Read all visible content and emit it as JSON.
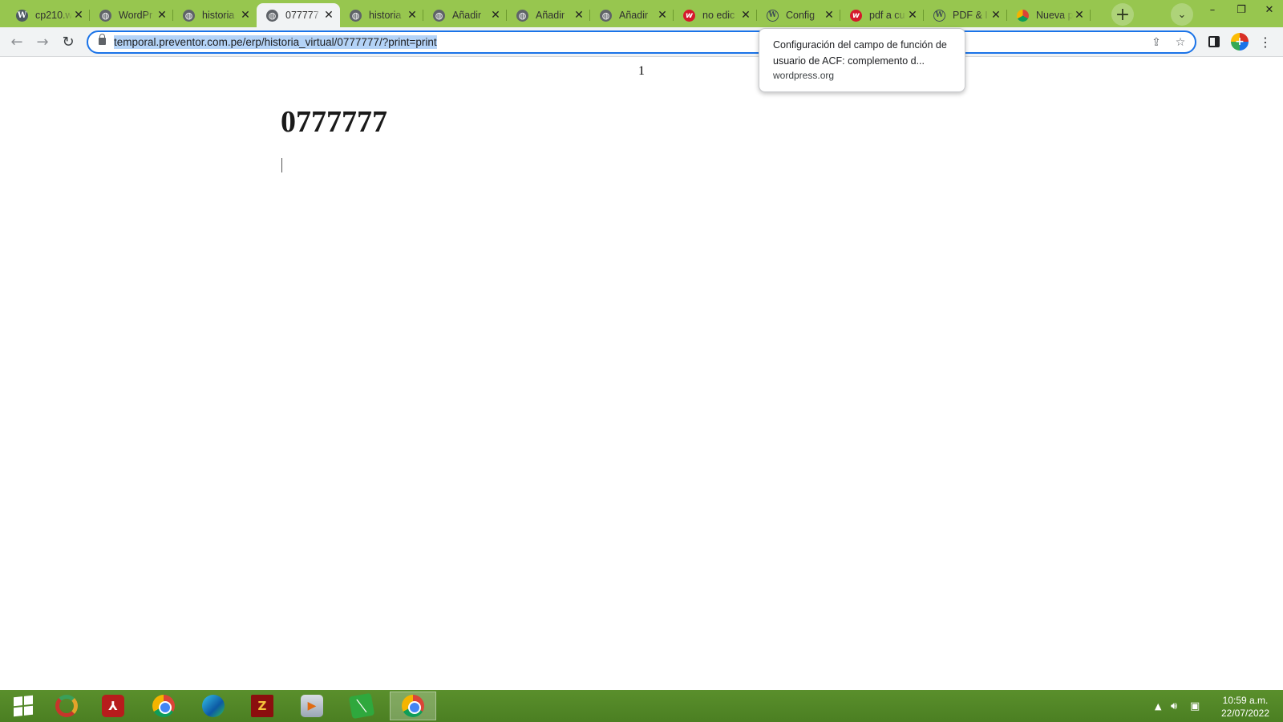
{
  "tabs": [
    {
      "title": "cp210.w",
      "icon": "wp-icon"
    },
    {
      "title": "WordPr",
      "icon": "globe-icon"
    },
    {
      "title": "historia",
      "icon": "globe-icon"
    },
    {
      "title": "077777",
      "icon": "globe-icon",
      "active": true
    },
    {
      "title": "historia",
      "icon": "globe-icon"
    },
    {
      "title": "Añadir",
      "icon": "globe-icon"
    },
    {
      "title": "Añadir",
      "icon": "globe-icon"
    },
    {
      "title": "Añadir",
      "icon": "globe-icon"
    },
    {
      "title": "no edic",
      "icon": "red-w-icon"
    },
    {
      "title": "Config",
      "icon": "wordpress-icon"
    },
    {
      "title": "pdf a cu",
      "icon": "red-w-icon"
    },
    {
      "title": "PDF & I",
      "icon": "wordpress-icon"
    },
    {
      "title": "Nueva p",
      "icon": "chrome-icon"
    }
  ],
  "toolbar": {
    "url": "temporal.preventor.com.pe/erp/historia_virtual/0777777/?print=print"
  },
  "tooltip": {
    "title": "Configuración del campo de función de usuario de ACF: complemento d...",
    "domain": "wordpress.org"
  },
  "page": {
    "page_number": "1",
    "heading": "0777777"
  },
  "taskbar": {
    "time": "10:59 a.m.",
    "date": "22/07/2022",
    "apps": [
      "windows-start-icon",
      "app-ring-icon",
      "acrobat-icon",
      "chrome-icon",
      "edge-icon",
      "filezilla-icon",
      "media-player-icon",
      "notes-icon",
      "chrome-active-icon"
    ]
  },
  "colors": {
    "tabstrip": "#97c64f",
    "omnibox_focus": "#1a73e8",
    "url_selection": "#b4d3f7",
    "taskbar": "#4b7f22"
  }
}
